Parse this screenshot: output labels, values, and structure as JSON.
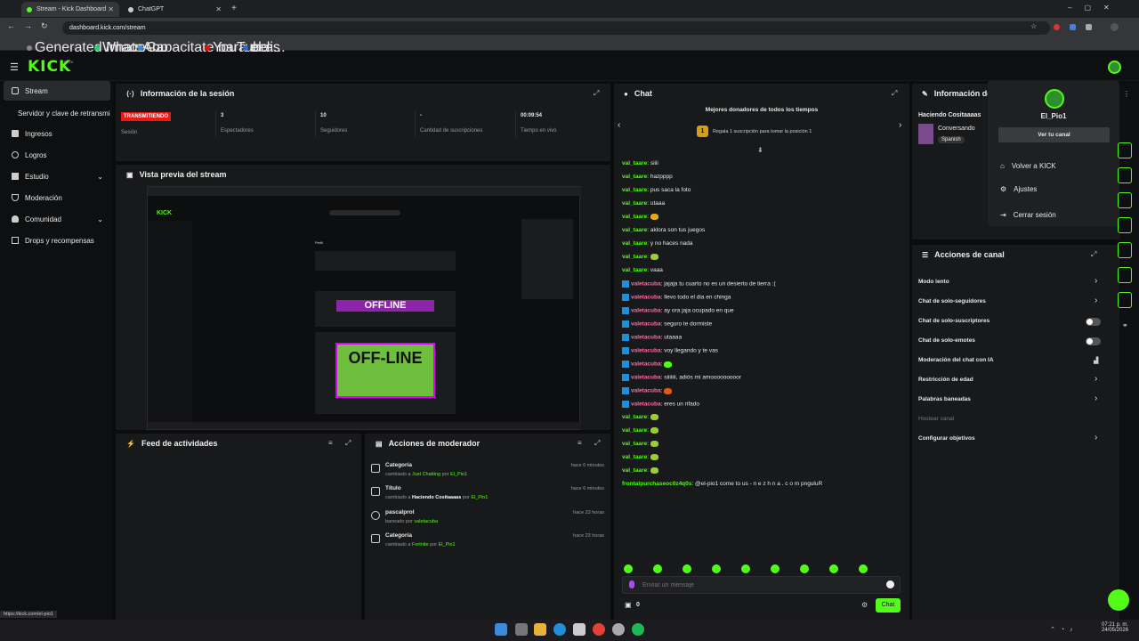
{
  "browser": {
    "tabs": [
      {
        "label": "Stream - Kick Dashboard"
      },
      {
        "label": "ChatGPT"
      }
    ],
    "url": "dashboard.kick.com/stream",
    "bookmarks": [
      "Generated Image -...",
      "WhatsApp",
      "Capacitate para el a...",
      "YouTube",
      "pelis"
    ],
    "status_url": "https://kick.com/el-pio1"
  },
  "app": {
    "logo": "KICK",
    "logo_badge": "BETA"
  },
  "sidebar": {
    "items": [
      {
        "label": "Stream",
        "icon": "radio-icon"
      },
      {
        "label": "Servidor y clave de retransmisión",
        "icon": ""
      },
      {
        "label": "Ingresos",
        "icon": "coins-icon"
      },
      {
        "label": "Logros",
        "icon": "trophy-icon"
      },
      {
        "label": "Estudio",
        "icon": "studio-icon"
      },
      {
        "label": "Moderación",
        "icon": "shield-icon"
      },
      {
        "label": "Comunidad",
        "icon": "users-icon"
      },
      {
        "label": "Drops y recompensas",
        "icon": "gift-icon"
      }
    ]
  },
  "session": {
    "title": "Información de la sesión",
    "status": "TRANSMITIENDO",
    "status_label": "Sesión",
    "stats": [
      {
        "value": "3",
        "label": "Espectadores"
      },
      {
        "value": "10",
        "label": "Seguidores"
      },
      {
        "value": "-",
        "label": "Cantidad de suscripciones"
      },
      {
        "value": "00:09:54",
        "label": "Tiempo en vivo"
      }
    ]
  },
  "preview": {
    "title": "Vista previa del stream",
    "inner_profile": "Perfil",
    "inner_offline": "OFFLINE",
    "inner_offline2": "OFF-LINE"
  },
  "feed": {
    "title": "Feed de actividades"
  },
  "mod_actions": {
    "title": "Acciones de moderador",
    "items": [
      {
        "title": "Categoría",
        "prefix": "cambiado a",
        "target": "Just Chatting",
        "by": "por",
        "user": "El_Pio1",
        "time": "hace 6 minutos"
      },
      {
        "title": "Título",
        "prefix": "cambiado a",
        "target": "Haciendo Cositaaaas",
        "by": "por",
        "user": "El_Pio1",
        "time": "hace 6 minutos"
      },
      {
        "title": "pascalprol",
        "prefix": "baneado por",
        "target": "",
        "by": "",
        "user": "valetacuba",
        "time": "hace 23 horas"
      },
      {
        "title": "Categoría",
        "prefix": "cambiado a",
        "target": "Fortnite",
        "by": "por",
        "user": "El_Pio1",
        "time": "hace 23 horas"
      }
    ]
  },
  "chat": {
    "title": "Chat",
    "donors_title": "Mejores donadores de todos los tiempos",
    "donors_rank": "1",
    "donors_cta": "Regala 1 suscripción para tomar la posición 1",
    "messages": [
      {
        "user": "val_taare",
        "text": "siiii"
      },
      {
        "user": "val_taare",
        "text": "hazpppp"
      },
      {
        "user": "val_taare",
        "text": "pus saca la foto"
      },
      {
        "user": "val_taare",
        "text": "utaaa"
      },
      {
        "user": "val_taare",
        "text": ""
      },
      {
        "user": "val_taare",
        "text": "aklora son tus juegos"
      },
      {
        "user": "val_taare",
        "text": "y no haces nada"
      },
      {
        "user": "val_taare",
        "text": ""
      },
      {
        "user": "val_taare",
        "text": "vaaa"
      },
      {
        "user": "valetacuba",
        "text": "jajaja tu cuarto no es un desierto de tierra :("
      },
      {
        "user": "valetacuba",
        "text": "llevo todo el dia en chinga"
      },
      {
        "user": "valetacuba",
        "text": "ay ora jaja ocupado en que"
      },
      {
        "user": "valetacuba",
        "text": "seguro te dormiste"
      },
      {
        "user": "valetacuba",
        "text": "utaaaa"
      },
      {
        "user": "valetacuba",
        "text": "voy llegando y te vas"
      },
      {
        "user": "valetacuba",
        "text": ""
      },
      {
        "user": "valetacuba",
        "text": "siiiiiii, adiós mi amooooooooor"
      },
      {
        "user": "valetacuba",
        "text": ""
      },
      {
        "user": "valetacuba",
        "text": "eres un rifado"
      },
      {
        "user": "val_taare",
        "text": ""
      },
      {
        "user": "val_taare",
        "text": ""
      },
      {
        "user": "val_taare",
        "text": ""
      },
      {
        "user": "val_taare",
        "text": ""
      },
      {
        "user": "val_taare",
        "text": ""
      },
      {
        "user": "frontalpurchaseoc0z4q0s",
        "text": "@el-pio1 come to us - n e z h n a . c o m pnguluR"
      }
    ],
    "input_placeholder": "Enviar un mensaje",
    "points": "0",
    "send_label": "Chat"
  },
  "channel_info": {
    "title": "Información del canal",
    "stream_title": "Haciendo Cositaaaas",
    "category": "Conversando",
    "language": "Spanish"
  },
  "channel_actions": {
    "title": "Acciones de canal",
    "items": [
      {
        "label": "Modo lento",
        "control": "arrow"
      },
      {
        "label": "Chat de solo-seguidores",
        "control": "arrow"
      },
      {
        "label": "Chat de solo-suscriptores",
        "control": "toggle"
      },
      {
        "label": "Chat de solo-emotes",
        "control": "toggle"
      },
      {
        "label": "Moderación del chat con IA",
        "control": "chart"
      },
      {
        "label": "Restricción de edad",
        "control": "arrow"
      },
      {
        "label": "Palabras baneadas",
        "control": "arrow"
      },
      {
        "label": "Hostear canal",
        "control": "none"
      },
      {
        "label": "Configurar objetivos",
        "control": "arrow"
      }
    ]
  },
  "user_menu": {
    "username": "El_Pio1",
    "view_channel": "Ver tu canal",
    "items": [
      "Volver a KICK",
      "Ajustes",
      "Cerrar sesión"
    ]
  },
  "taskbar": {
    "time": "07:21 p. m.",
    "date": "24/05/2026"
  },
  "colors": {
    "accent": "#53fc18",
    "live": "#e91916",
    "panel": "#18191b",
    "bg": "#0b0c0d"
  }
}
